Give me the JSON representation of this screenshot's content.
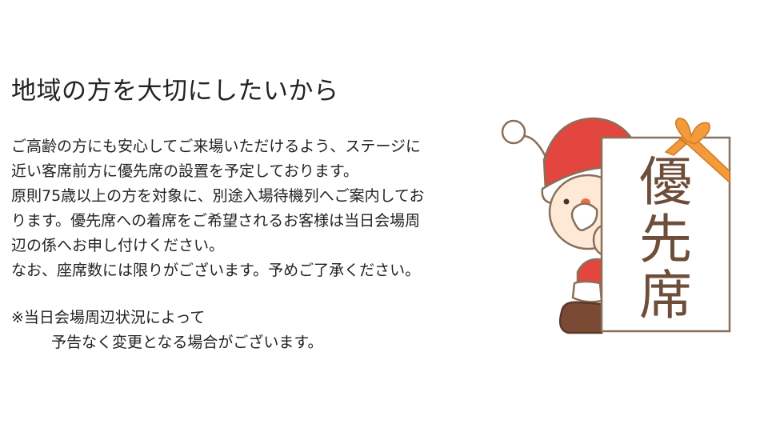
{
  "slide": {
    "title": "地域の方を大切にしたいから",
    "paragraph_lines": [
      "ご高齢の方にも安心してご来場いただけるよう、ステージに",
      "近い客席前方に優先席の設置を予定しております。",
      "原則75歳以上の方を対象に、別途入場待機列へご案内してお",
      "ります。優先席への着席をご希望されるお客様は当日会場周",
      "辺の係へお申し付けください。",
      "なお、座席数には限りがございます。予めご了承ください。"
    ],
    "note_lines": [
      "※当日会場周辺状況によって",
      "予告なく変更となる場合がございます。"
    ]
  },
  "illustration": {
    "icon": "santa-holding-sign-icon",
    "sign_characters": [
      "優",
      "先",
      "席"
    ],
    "colors": {
      "hat": "#e2463e",
      "ribbon": "#f39a3b",
      "outline": "#8a6f5a",
      "text": "#6e4e3a",
      "face": "#fde9d6",
      "boot": "#7a4a35"
    }
  }
}
